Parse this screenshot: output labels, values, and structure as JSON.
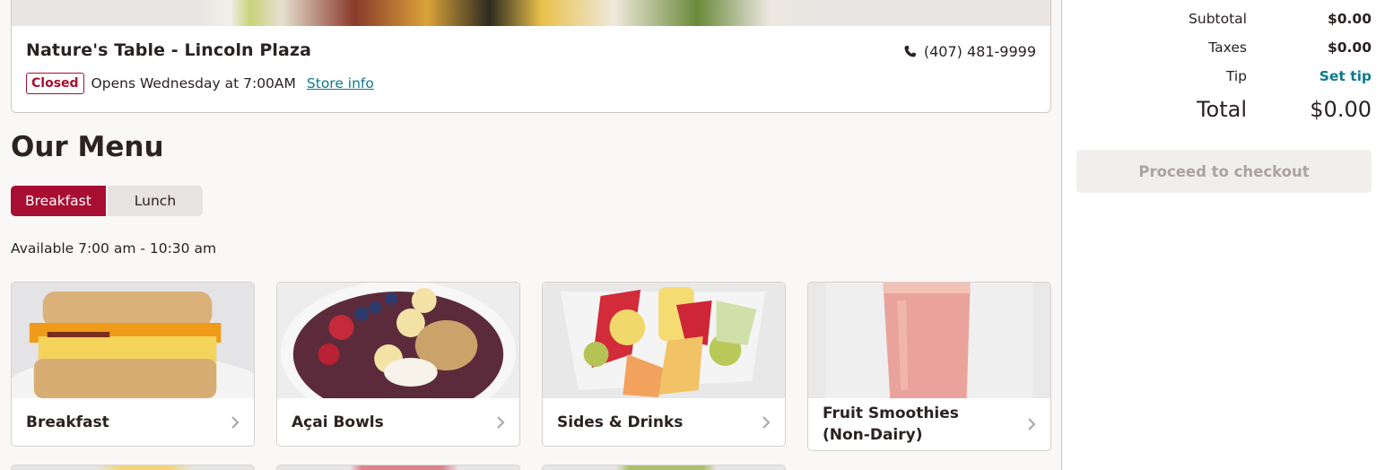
{
  "store": {
    "name": "Nature's Table - Lincoln Plaza",
    "phone": "(407) 481-9999",
    "status_badge": "Closed",
    "opens_text": "Opens Wednesday at 7:00AM",
    "store_info_link": "Store info"
  },
  "menu": {
    "title": "Our Menu",
    "tabs": [
      {
        "label": "Breakfast",
        "active": true
      },
      {
        "label": "Lunch",
        "active": false
      }
    ],
    "availability": "Available 7:00 am - 10:30 am",
    "categories": [
      {
        "label": "Breakfast",
        "image": "breakfast-sandwich"
      },
      {
        "label": "Açai Bowls",
        "image": "acai-bowl"
      },
      {
        "label": "Sides & Drinks",
        "image": "fruit-cup"
      },
      {
        "label": "Fruit Smoothies (Non-Dairy)",
        "image": "smoothie"
      }
    ]
  },
  "cart": {
    "subtotal_label": "Subtotal",
    "subtotal_value": "$0.00",
    "taxes_label": "Taxes",
    "taxes_value": "$0.00",
    "tip_label": "Tip",
    "tip_value": "Set tip",
    "total_label": "Total",
    "total_value": "$0.00",
    "checkout_label": "Proceed to checkout"
  },
  "colors": {
    "brand": "#a80e32",
    "link": "#0e7a8c",
    "background": "#faf8f6"
  },
  "icons": {
    "phone": "phone-icon",
    "chevron": "chevron-right-icon"
  }
}
